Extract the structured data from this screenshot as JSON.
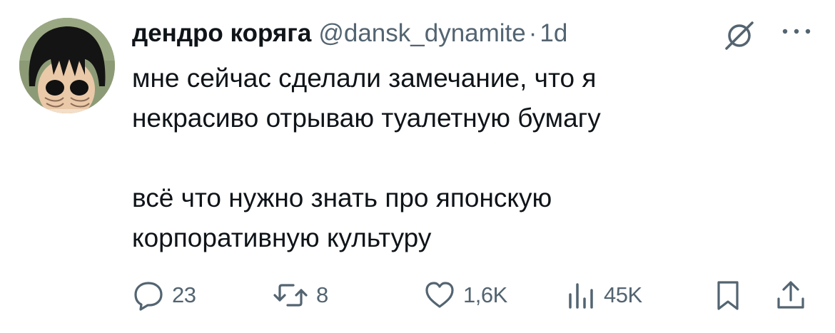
{
  "tweet": {
    "display_name": "дендро коряга",
    "handle": "@dansk_dynamite",
    "separator": "·",
    "time": "1d",
    "text": "мне сейчас сделали замечание, что я\nнекрасиво отрываю туалетную бумагу\n\nвсё что нужно знать про японскую\nкорпоративную культуру"
  },
  "actions": {
    "replies": "23",
    "reposts": "8",
    "likes": "1,6K",
    "views": "45K"
  },
  "icons": {
    "reply": "speech-bubble-icon",
    "repost": "repost-arrows-icon",
    "like": "heart-icon",
    "views": "bar-chart-icon",
    "bookmark": "bookmark-icon",
    "share": "share-upload-icon",
    "grok": "grok-icon",
    "more": "more-dots-icon"
  },
  "colors": {
    "text": "#0f1419",
    "secondary": "#536471",
    "background": "#ffffff"
  }
}
